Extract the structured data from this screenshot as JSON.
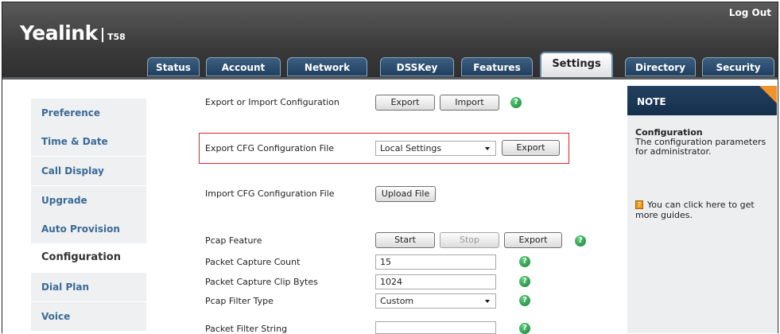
{
  "header": {
    "brand": "Yealink",
    "model": "T58",
    "logout_label": "Log Out"
  },
  "tabs": [
    {
      "label": "Status"
    },
    {
      "label": "Account"
    },
    {
      "label": "Network"
    },
    {
      "label": "DSSKey"
    },
    {
      "label": "Features"
    },
    {
      "label": "Settings",
      "active": true
    },
    {
      "label": "Directory"
    },
    {
      "label": "Security"
    }
  ],
  "sidebar": {
    "items": [
      {
        "label": "Preference"
      },
      {
        "label": "Time & Date"
      },
      {
        "label": "Call Display"
      },
      {
        "label": "Upgrade"
      },
      {
        "label": "Auto Provision"
      },
      {
        "label": "Configuration",
        "active": true
      },
      {
        "label": "Dial Plan"
      },
      {
        "label": "Voice"
      }
    ]
  },
  "main": {
    "export_import": {
      "label": "Export or Import Configuration",
      "export_label": "Export",
      "import_label": "Import"
    },
    "export_cfg": {
      "label": "Export CFG Configuration File",
      "select_value": "Local Settings",
      "export_label": "Export"
    },
    "import_cfg": {
      "label": "Import CFG Configuration File",
      "upload_label": "Upload File"
    },
    "pcap": {
      "label": "Pcap Feature",
      "start_label": "Start",
      "stop_label": "Stop",
      "export_label": "Export"
    },
    "capture_count": {
      "label": "Packet Capture Count",
      "value": "15"
    },
    "clip_bytes": {
      "label": "Packet Capture Clip Bytes",
      "value": "1024"
    },
    "filter_type": {
      "label": "Pcap Filter Type",
      "value": "Custom"
    },
    "filter_string": {
      "label": "Packet Filter String",
      "value": ""
    },
    "help_glyph": "?"
  },
  "note": {
    "heading": "NOTE",
    "title": "Configuration",
    "text_line1": "The configuration parameters",
    "text_line2": "for administrator.",
    "guide_line1": "You can click here to get",
    "guide_line2": "more guides."
  },
  "colors": {
    "accent_blue": "#3c6a96",
    "highlight_red": "#e3232a",
    "help_green": "#19803a",
    "note_corner": "#f0922e"
  }
}
